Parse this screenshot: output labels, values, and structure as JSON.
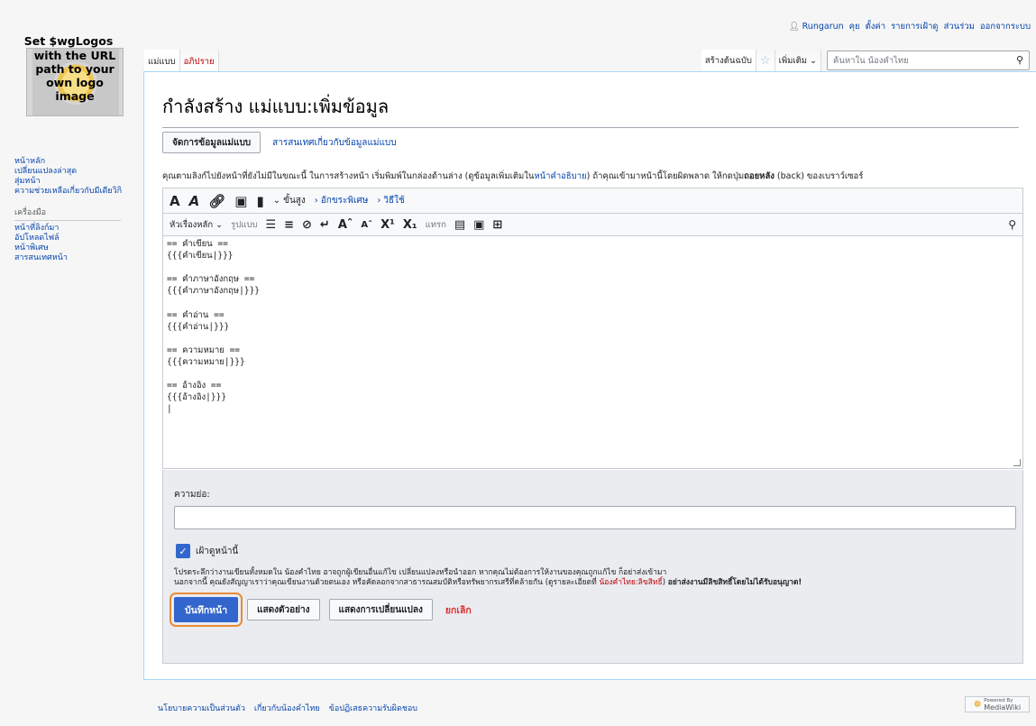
{
  "personal": {
    "user": "Rungarun",
    "items": [
      "คุย",
      "ตั้งค่า",
      "รายการเฝ้าดู",
      "ส่วนร่วม",
      "ออกจากระบบ"
    ]
  },
  "logo": {
    "line1": "Set $wgLogos",
    "line2": "with the URL",
    "line3": "path to your",
    "line4": "own logo",
    "line5": "image"
  },
  "sidebar": {
    "nav": [
      "หน้าหลัก",
      "เปลี่ยนแปลงล่าสุด",
      "สุ่มหน้า",
      "ความช่วยเหลือเกี่ยวกับมีเดียวิกิ"
    ],
    "tools_heading": "เครื่องมือ",
    "tools": [
      "หน้าที่ลิงก์มา",
      "อัปโหลดไฟล์",
      "หน้าพิเศษ",
      "สารสนเทศหน้า"
    ]
  },
  "tabs": {
    "template": "แม่แบบ",
    "talk": "อภิปราย",
    "create": "สร้างต้นฉบับ",
    "more": "เพิ่มเติม",
    "search_placeholder": "ค้นหาใน น้องคำไทย"
  },
  "page": {
    "title": "กำลังสร้าง แม่แบบ:เพิ่มข้อมูล",
    "manage_button": "จัดการข้อมูลแม่แบบ",
    "templatedata_link": "สารสนเทศเกี่ยวกับข้อมูลแม่แบบ",
    "notice_before": "คุณตามลิงก์ไปยังหน้าที่ยังไม่มีในขณะนี้ ในการสร้างหน้า เริ่มพิมพ์ในกล่องด้านล่าง (ดูข้อมูลเพิ่มเติมใน",
    "notice_link": "หน้าคำอธิบาย",
    "notice_mid": ") ถ้าคุณเข้ามาหน้านี้โดยผิดพลาด ให้กดปุ่ม",
    "notice_bold": "ถอยหลัง",
    "notice_after": " (back) ของเบราว์เซอร์"
  },
  "toolbar": {
    "advanced": "ขั้นสูง",
    "special_chars": "อักขระพิเศษ",
    "help": "วิธีใช้",
    "heading": "หัวเรื่องหลัก",
    "format": "รูปแบบ",
    "insert": "แทรก"
  },
  "editor": {
    "content": "== คำเขียน ==\n{{{คำเขียน|}}}\n\n== คำภาษาอังกฤษ ==\n{{{คำภาษาอังกฤษ|}}}\n\n== คำอ่าน ==\n{{{คำอ่าน|}}}\n\n== ความหมาย ==\n{{{ความหมาย|}}}\n\n== อ้างอิง ==\n{{{อ้างอิง|}}}\n|"
  },
  "options": {
    "summary_label": "ความย่อ:",
    "summary_value": "",
    "watch_label": "เฝ้าดูหน้านี้",
    "watch_checked": true,
    "license_line1": "โปรดระลึกว่างานเขียนทั้งหมดใน น้องคำไทย อาจถูกผู้เขียนอื่นแก้ไข เปลี่ยนแปลงหรือนำออก หากคุณไม่ต้องการให้งานของคุณถูกแก้ไข ก็อย่าส่งเข้ามา",
    "license_line2_a": "นอกจากนี้ คุณยังสัญญาเราว่าคุณเขียนงานด้วยตนเอง หรือคัดลอกจากสาธารณสมบัติหรือทรัพยากรเสรีที่คล้ายกัน (ดูรายละเอียดที่ ",
    "license_link": "น้องคำไทย:ลิขสิทธิ์",
    "license_line2_b": ") ",
    "license_bold": "อย่าส่งงานมีลิขสิทธิ์โดยไม่ได้รับอนุญาต!",
    "save": "บันทึกหน้า",
    "preview": "แสดงตัวอย่าง",
    "diff": "แสดงการเปลี่ยนแปลง",
    "cancel": "ยกเลิก"
  },
  "footer": {
    "links": [
      "นโยบายความเป็นส่วนตัว",
      "เกี่ยวกับน้องคำไทย",
      "ข้อปฏิเสธความรับผิดชอบ"
    ],
    "powered_small": "Powered By",
    "powered": "MediaWiki"
  },
  "colors": {
    "link": "#0645ad",
    "redlink": "#ba0000",
    "primary_button": "#3366cc",
    "focus_outline": "#e98b39"
  }
}
